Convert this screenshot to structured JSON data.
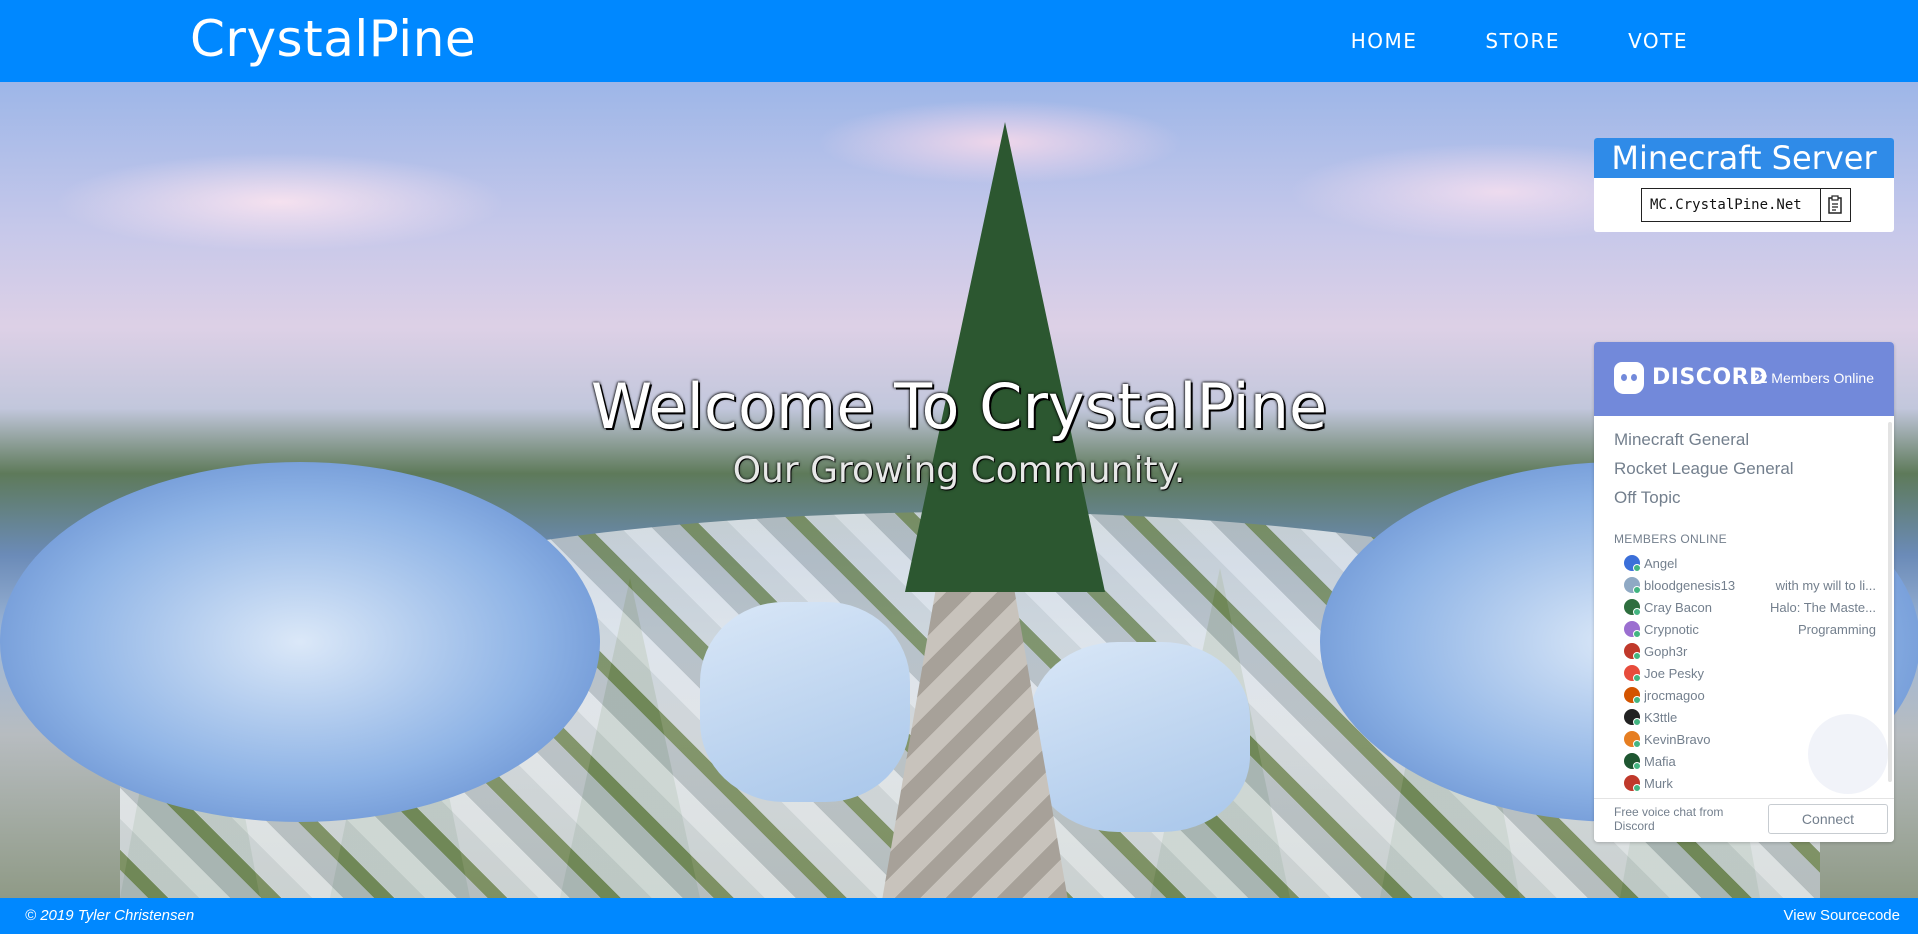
{
  "header": {
    "brand": "CrystalPine",
    "nav": [
      "HOME",
      "STORE",
      "VOTE"
    ]
  },
  "hero": {
    "title": "Welcome To CrystalPine",
    "subtitle": "Our Growing Community."
  },
  "server_ip": {
    "heading": "Minecraft Server Ip",
    "address": "MC.CrystalPine.Net",
    "copy_icon": "clipboard-icon"
  },
  "discord": {
    "brand": "DISCORD",
    "online_count": "22",
    "online_label": "Members Online",
    "channels": [
      "Minecraft General",
      "Rocket League General",
      "Off Topic"
    ],
    "members_label": "MEMBERS ONLINE",
    "members": [
      {
        "name": "Angel",
        "game": "",
        "color": "#3b6fd9"
      },
      {
        "name": "bloodgenesis13",
        "game": "with my will to li...",
        "color": "#8fa9c4"
      },
      {
        "name": "Cray Bacon",
        "game": "Halo: The Maste...",
        "color": "#2e6e3e"
      },
      {
        "name": "Crypnotic",
        "game": "Programming",
        "color": "#9b6fd0"
      },
      {
        "name": "Goph3r",
        "game": "",
        "color": "#c0392b"
      },
      {
        "name": "Joe Pesky",
        "game": "",
        "color": "#e74c3c"
      },
      {
        "name": "jrocmagoo",
        "game": "",
        "color": "#d35400"
      },
      {
        "name": "K3ttle",
        "game": "",
        "color": "#222222"
      },
      {
        "name": "KevinBravo",
        "game": "",
        "color": "#e67e22"
      },
      {
        "name": "Mafia",
        "game": "",
        "color": "#1e5631"
      },
      {
        "name": "Murk",
        "game": "",
        "color": "#c0392b"
      }
    ],
    "footer_text": "Free voice chat from Discord",
    "connect_label": "Connect"
  },
  "footer": {
    "copyright": "© 2019 Tyler Christensen",
    "source_link": "View Sourcecode"
  },
  "colors": {
    "primary": "#0088ff",
    "discord": "#7289da",
    "ip_header": "#2f8be8"
  }
}
